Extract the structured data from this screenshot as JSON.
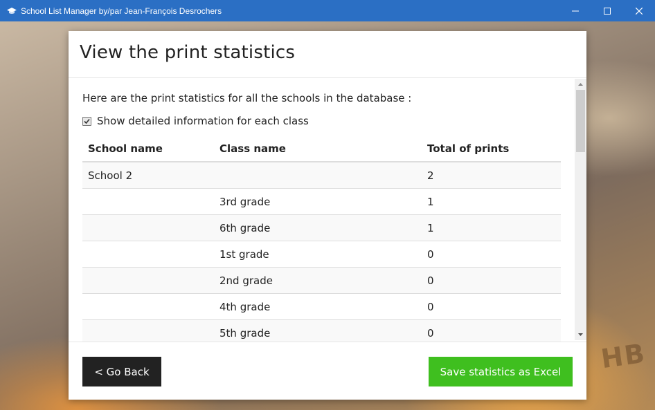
{
  "window": {
    "title": "School List Manager by/par Jean-François Desrochers",
    "minimize_icon": "minimize-icon",
    "maximize_icon": "maximize-icon",
    "close_icon": "close-icon"
  },
  "background": {
    "pencil_text": "HB"
  },
  "dialog": {
    "title": "View the print statistics",
    "intro": "Here are the print statistics for all the schools in the database :",
    "checkbox": {
      "label": "Show detailed information for each class",
      "checked": true
    },
    "table": {
      "headers": [
        "School name",
        "Class name",
        "Total of prints"
      ],
      "rows": [
        [
          "School 2",
          "",
          "2"
        ],
        [
          "",
          "3rd grade",
          "1"
        ],
        [
          "",
          "6th grade",
          "1"
        ],
        [
          "",
          "1st grade",
          "0"
        ],
        [
          "",
          "2nd grade",
          "0"
        ],
        [
          "",
          "4th grade",
          "0"
        ],
        [
          "",
          "5th grade",
          "0"
        ]
      ]
    },
    "footer": {
      "back_label": "< Go Back",
      "save_label": "Save statistics as Excel"
    }
  },
  "colors": {
    "titlebar": "#2b6fc4",
    "save_button": "#3fbf1f",
    "back_button": "#222222"
  }
}
